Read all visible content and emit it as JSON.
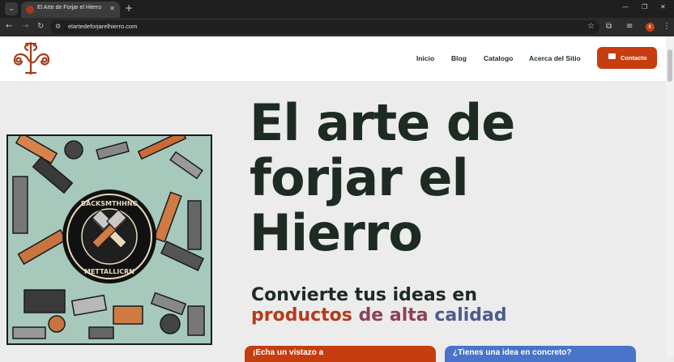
{
  "browser": {
    "tab_title": "El Arte de Forjar el Hierro",
    "url": "elartedeforjarelhierro.com",
    "profile_initial": "K"
  },
  "header": {
    "nav": [
      "Inicio",
      "Blog",
      "Catalogo",
      "Acerca del Sitio"
    ],
    "contact_label": "Contacto",
    "accent": "#c63d0f"
  },
  "hero": {
    "title": "El arte de forjar el Hierro",
    "subtitle_line1": "Convierte tus ideas en",
    "subtitle_words": [
      "productos",
      "de alta",
      "calidad"
    ],
    "image_badge_top": "BACKSMTHHNG",
    "image_badge_bottom": "METTALLICRN",
    "cta_left": "¡Echa un vistazo a",
    "cta_right": "¿Tienes una idea en concreto?"
  }
}
